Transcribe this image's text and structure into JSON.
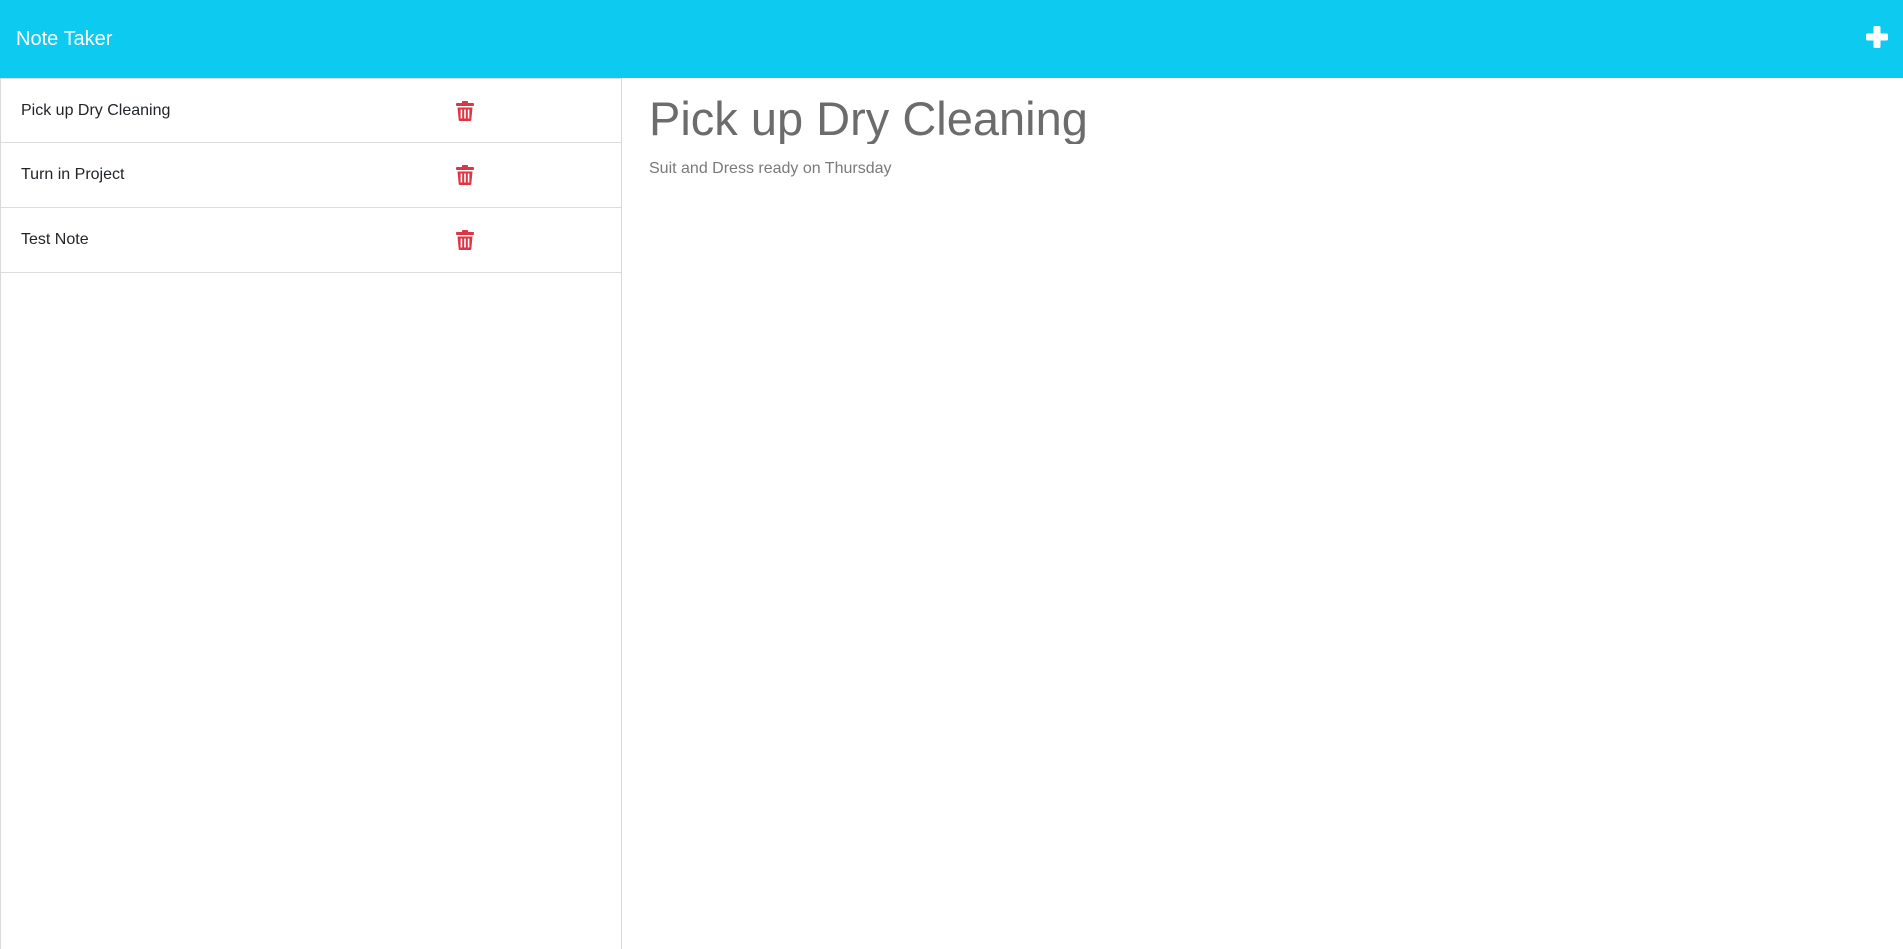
{
  "navbar": {
    "brand": "Note Taker",
    "new_note_icon": "plus-icon",
    "color": "#0dcaf0"
  },
  "sidebar": {
    "notes": [
      {
        "title": "Pick up Dry Cleaning",
        "delete_icon": "trash-icon"
      },
      {
        "title": "Turn in Project",
        "delete_icon": "trash-icon"
      },
      {
        "title": "Test Note",
        "delete_icon": "trash-icon"
      }
    ],
    "delete_color": "#dc3545"
  },
  "main": {
    "note_title": "Pick up Dry Cleaning",
    "note_text": "Suit and Dress ready on Thursday"
  }
}
